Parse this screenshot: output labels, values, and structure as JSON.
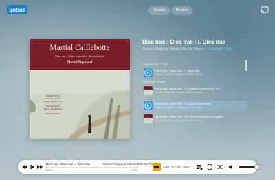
{
  "app": {
    "logo_text": "qobuz"
  },
  "header": {
    "credits_label": "Credits",
    "booklet_label": "Booklet",
    "cast_icon": "cast-icon"
  },
  "album": {
    "cover_title": "Martial Caillebotte",
    "cover_subtitle": "Dies iræ · Ultra Jesuitefu · Beautifie pit",
    "cover_conductor": "Michel Piquemal",
    "cover_credits": [
      "Ensemble Vittoria",
      "& Choeur Régional",
      "Vittoria d'Île-de-France",
      "Choeur Régional",
      "Vittoria d'Île-de-France",
      "Michel Piquemal"
    ]
  },
  "now_playing": {
    "title": "Dies irae : Dies irae : I. Dies irae",
    "artist": "Choeur Régional Vittoria D'Île De France",
    "composer": "Caillebotte: Dies",
    "more_icon": "more-icon"
  },
  "queue": {
    "selected_label": "Abgespielter Track",
    "next_label": "Folgende Tracks",
    "items": [
      {
        "title": "Dies irae : Dies irae : I. Dies irae",
        "artist": "Choeur Régional Vittoria D'Île De France",
        "state": "played"
      },
      {
        "title": "Dies irae : Dies irae : II. Quantus tremor est fut...",
        "artist": "Choeur Régional Vittoria D'Île De France",
        "state": "next"
      },
      {
        "title": "Dies irae : Dies irae : III. Quid sum miser",
        "artist": "Choeur Régional Vittoria D'Île De France",
        "state": "active"
      },
      {
        "title": "Dies irae : Dies irae : IV. Inter oves locum praesta",
        "artist": "Choeur Régional Vittoria D'Île De France",
        "state": "next"
      }
    ]
  },
  "player": {
    "title": "Dies irae : Dies irae : I. Dies irae",
    "artist": "Choeur Régional Vittoria D'Île De France",
    "elapsed": "00:01",
    "total": "04:39",
    "progress": 0.01,
    "quality": "16-Bit / 44.1 kHz · Stereo",
    "volume": 0.75
  },
  "colors": {
    "accent": "#3a9fde",
    "logo_bg": "#1f7fbf",
    "cover_band": "#7a1e2a"
  }
}
